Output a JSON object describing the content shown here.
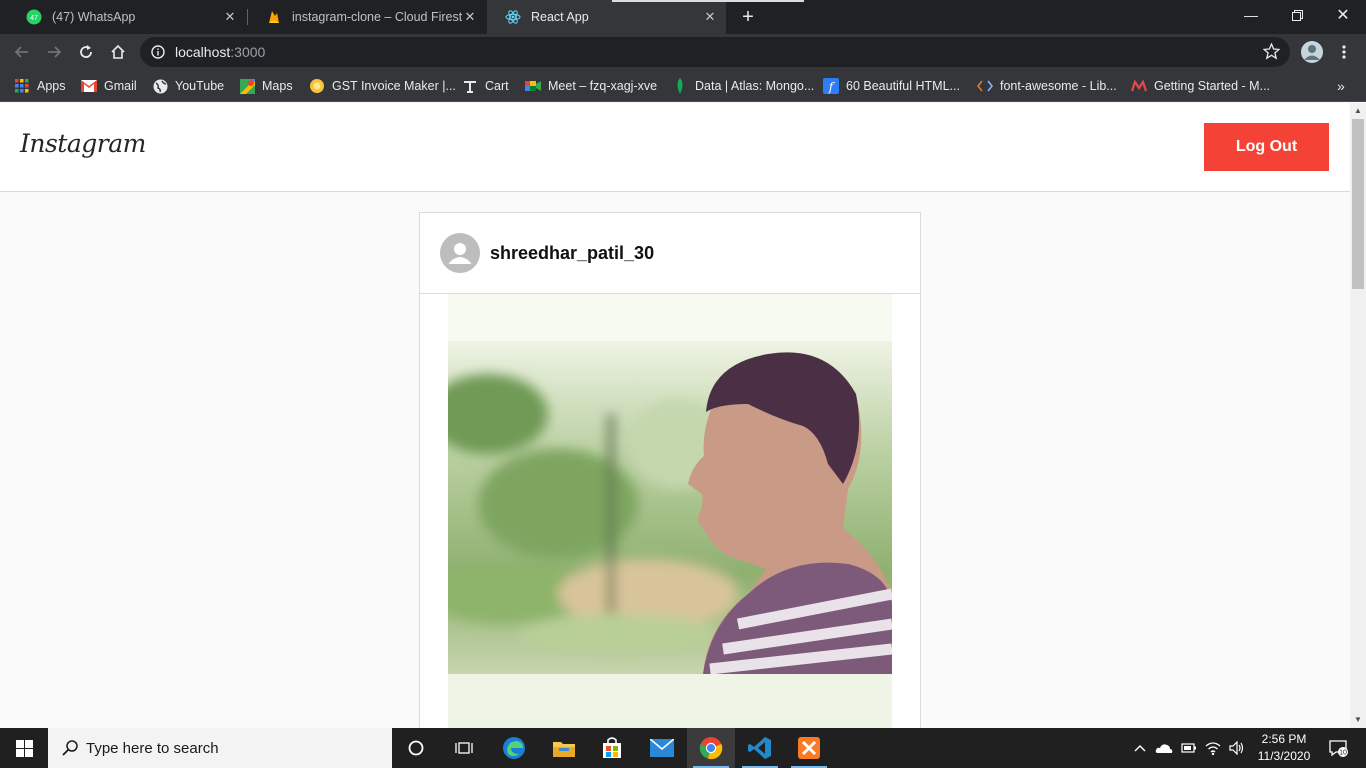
{
  "browser": {
    "tabs": [
      {
        "title": "(47) WhatsApp",
        "badge": "47",
        "icon": "whatsapp-icon"
      },
      {
        "title": "instagram-clone – Cloud Firestore",
        "icon": "firebase-icon"
      },
      {
        "title": "React App",
        "icon": "react-icon",
        "active": true
      }
    ],
    "address": {
      "host": "localhost",
      "port": ":3000"
    },
    "bookmarks": [
      {
        "label": "Apps",
        "icon": "apps-grid-icon"
      },
      {
        "label": "Gmail",
        "icon": "gmail-icon"
      },
      {
        "label": "YouTube",
        "icon": "globe-icon"
      },
      {
        "label": "Maps",
        "icon": "maps-icon"
      },
      {
        "label": "GST Invoice Maker |...",
        "icon": "gst-icon"
      },
      {
        "label": "Cart",
        "icon": "cart-icon"
      },
      {
        "label": "Meet – fzq-xagj-xve",
        "icon": "meet-icon"
      },
      {
        "label": "Data | Atlas: Mongo...",
        "icon": "mongodb-leaf-icon"
      },
      {
        "label": "60 Beautiful HTML...",
        "icon": "f-icon"
      },
      {
        "label": "font-awesome - Lib...",
        "icon": "code-icon"
      },
      {
        "label": "Getting Started - M...",
        "icon": "m-icon"
      }
    ]
  },
  "page": {
    "logo": "Instagram",
    "logout_label": "Log Out",
    "post": {
      "username": "shreedhar_patil_30"
    }
  },
  "taskbar": {
    "search_placeholder": "Type here to search",
    "time": "2:56 PM",
    "date": "11/3/2020",
    "notifications": "10"
  },
  "colors": {
    "logout": "#f44336",
    "chrome_dark": "#202124",
    "chrome_toolbar": "#35363a"
  }
}
